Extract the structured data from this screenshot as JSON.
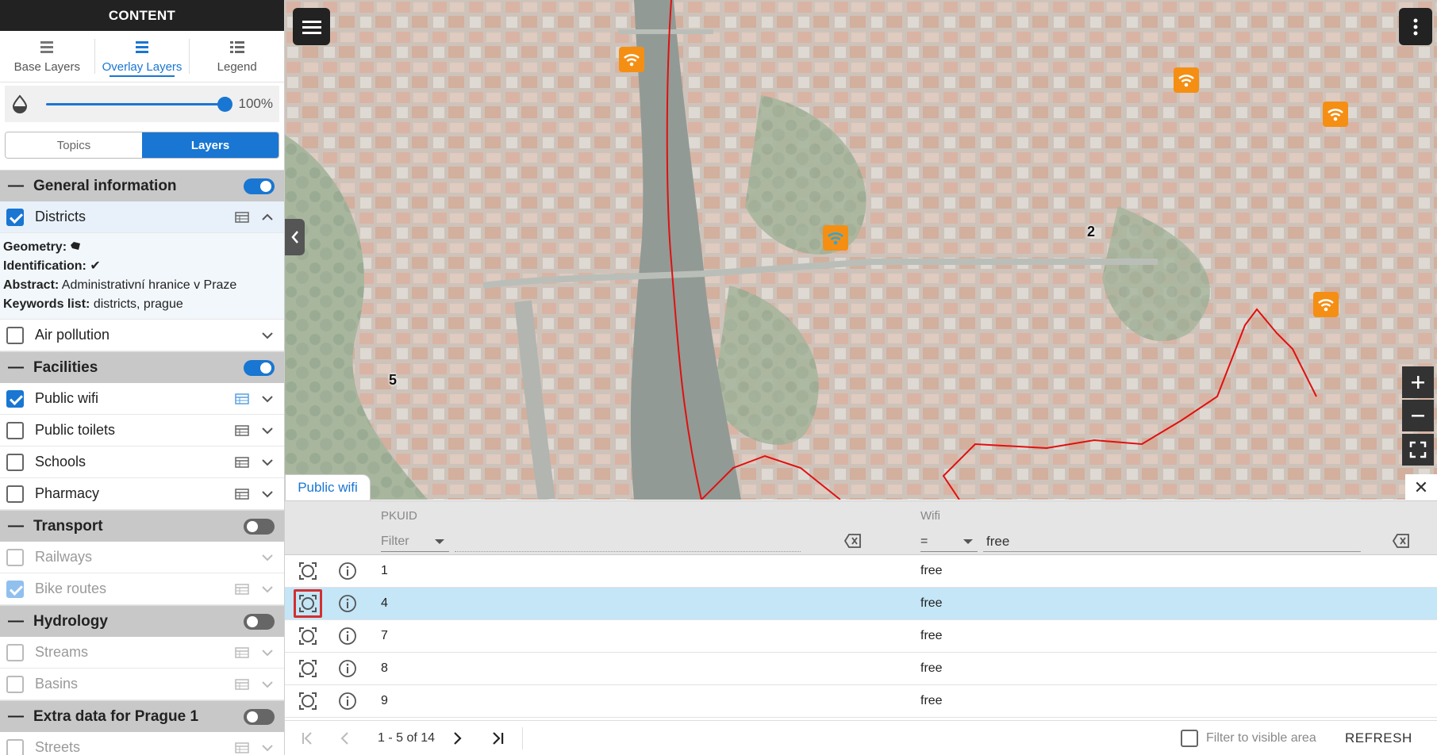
{
  "sidebar": {
    "title": "CONTENT",
    "tabs": [
      {
        "label": "Base Layers",
        "icon": "base-layers-icon"
      },
      {
        "label": "Overlay Layers",
        "icon": "overlay-layers-icon"
      },
      {
        "label": "Legend",
        "icon": "legend-icon"
      }
    ],
    "opacity": {
      "value": "100%",
      "fraction": 1.0
    },
    "view_toggle": {
      "topics": "Topics",
      "layers": "Layers"
    },
    "groups": [
      {
        "name": "General information",
        "on": true
      },
      {
        "name": "Facilities",
        "on": true
      },
      {
        "name": "Transport",
        "on": false
      },
      {
        "name": "Hydrology",
        "on": false
      },
      {
        "name": "Extra data for Prague 1",
        "on": false
      }
    ],
    "layers": {
      "districts": {
        "name": "Districts",
        "checked": true
      },
      "air_pollution": {
        "name": "Air pollution",
        "checked": false
      },
      "public_wifi": {
        "name": "Public wifi",
        "checked": true
      },
      "public_toilets": {
        "name": "Public toilets",
        "checked": false
      },
      "schools": {
        "name": "Schools",
        "checked": false
      },
      "pharmacy": {
        "name": "Pharmacy",
        "checked": false
      },
      "railways": {
        "name": "Railways",
        "checked": false
      },
      "bike_routes": {
        "name": "Bike routes",
        "checked": true
      },
      "streams": {
        "name": "Streams",
        "checked": false
      },
      "basins": {
        "name": "Basins",
        "checked": false
      },
      "streets": {
        "name": "Streets",
        "checked": false
      }
    },
    "districts_meta": {
      "geometry_label": "Geometry:",
      "identification_label": "Identification:",
      "abstract_label": "Abstract:",
      "abstract_value": "Administrativní hranice v Praze",
      "keywords_label": "Keywords list:",
      "keywords_value": "districts, prague"
    }
  },
  "map": {
    "district_labels": [
      "5",
      "2"
    ],
    "wifi_icon": "wifi-icon"
  },
  "attribute_table": {
    "tab_label": "Public wifi",
    "columns": {
      "pkuid": "PKUID",
      "wifi": "Wifi"
    },
    "pkuid_filter": {
      "operator_placeholder": "Filter",
      "value": ""
    },
    "wifi_filter": {
      "operator": "=",
      "value": "free"
    },
    "rows": [
      {
        "pkuid": "1",
        "wifi": "free"
      },
      {
        "pkuid": "4",
        "wifi": "free"
      },
      {
        "pkuid": "7",
        "wifi": "free"
      },
      {
        "pkuid": "8",
        "wifi": "free"
      },
      {
        "pkuid": "9",
        "wifi": "free"
      }
    ],
    "pager": {
      "range": "1 - 5 of 14"
    },
    "filter_visible_label": "Filter to visible area",
    "refresh_label": "REFRESH"
  }
}
